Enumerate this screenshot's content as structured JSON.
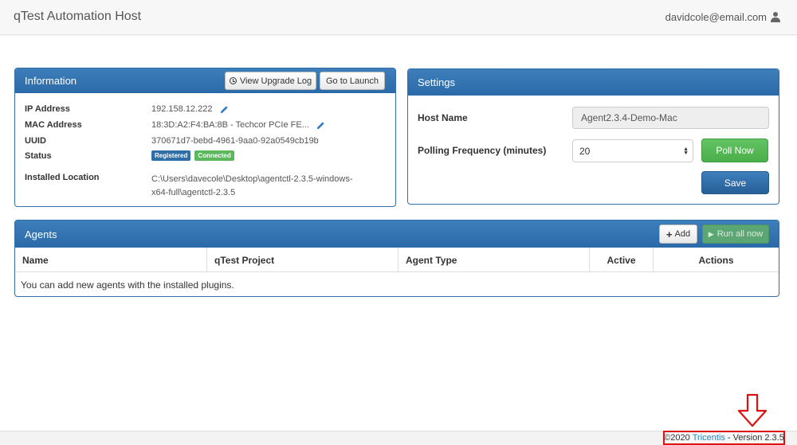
{
  "header": {
    "app_title": "qTest Automation Host",
    "user_email": "davidcole@email.com",
    "user_icon": "user-icon"
  },
  "information": {
    "title": "Information",
    "view_upgrade_log_label": "View Upgrade Log",
    "go_to_launch_label": "Go to Launch",
    "ip_label": "IP Address",
    "ip_value": "192.158.12.222",
    "mac_label": "MAC Address",
    "mac_value": "18:3D:A2:F4:BA:8B - Techcor PCIe FE...",
    "uuid_label": "UUID",
    "uuid_value": "370671d7-bebd-4961-9aa0-92a0549cb19b",
    "status_label": "Status",
    "status_registered": "Registered",
    "status_connected": "Connected",
    "location_label": "Installed Location",
    "location_line1": "C:\\Users\\davecole\\Desktop\\agentctl-2.3.5-windows-",
    "location_line2": "x64-full\\agentctl-2.3.5"
  },
  "settings": {
    "title": "Settings",
    "host_name_label": "Host Name",
    "host_name_value": "Agent2.3.4-Demo-Mac",
    "polling_label": "Polling Frequency (minutes)",
    "polling_value": "20",
    "poll_now_label": "Poll Now",
    "save_label": "Save"
  },
  "agents": {
    "title": "Agents",
    "add_label": "Add",
    "run_all_label": "Run all now",
    "columns": [
      "Name",
      "qTest Project",
      "Agent Type",
      "Active",
      "Actions"
    ],
    "empty_message": "You can add new agents with the installed plugins."
  },
  "footer": {
    "copyright": "©2020",
    "company_link": "Tricentis",
    "version": "- Version 2.3.5"
  },
  "colors": {
    "panel_blue": "#2f6ea6",
    "success_green": "#5cb85c",
    "link_blue": "#1e88c8",
    "highlight_red": "#d11111"
  }
}
